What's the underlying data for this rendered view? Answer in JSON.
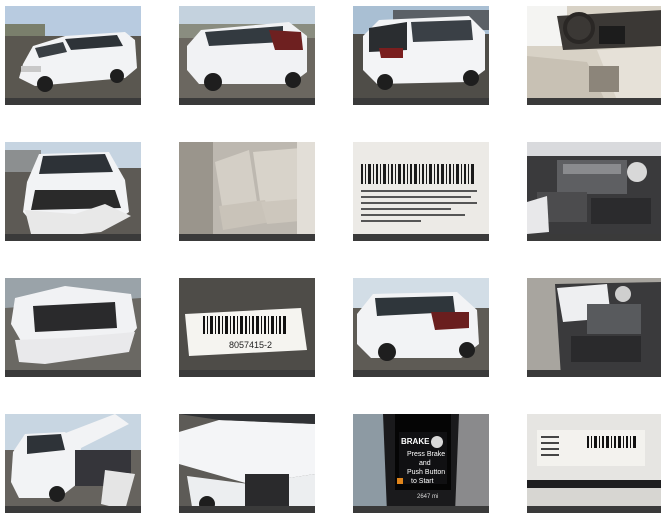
{
  "gallery": {
    "photos": [
      {
        "subject": "front-left-exterior"
      },
      {
        "subject": "rear-left-exterior"
      },
      {
        "subject": "rear-right-exterior"
      },
      {
        "subject": "interior-dashboard"
      },
      {
        "subject": "front-damage"
      },
      {
        "subject": "rear-seats"
      },
      {
        "subject": "vin-label"
      },
      {
        "subject": "engine-bay"
      },
      {
        "subject": "front-damage-closeup"
      },
      {
        "subject": "barcode-sticker"
      },
      {
        "subject": "rear-left-exterior-2"
      },
      {
        "subject": "engine-bay-2"
      },
      {
        "subject": "hood-open-front"
      },
      {
        "subject": "hood-damage"
      },
      {
        "subject": "instrument-cluster"
      },
      {
        "subject": "door-label"
      }
    ],
    "barcode_number": "8057415-2",
    "cluster": {
      "title": "BRAKE",
      "line1": "Press Brake",
      "line2": "and",
      "line3": "Push Button",
      "line4": "to Start",
      "odometer": "2647 mi"
    },
    "colors": {
      "car_white": "#f2f3f5",
      "asphalt": "#4a4a4a",
      "sky": "#b9cde0",
      "interior": "#cfcac1"
    }
  }
}
